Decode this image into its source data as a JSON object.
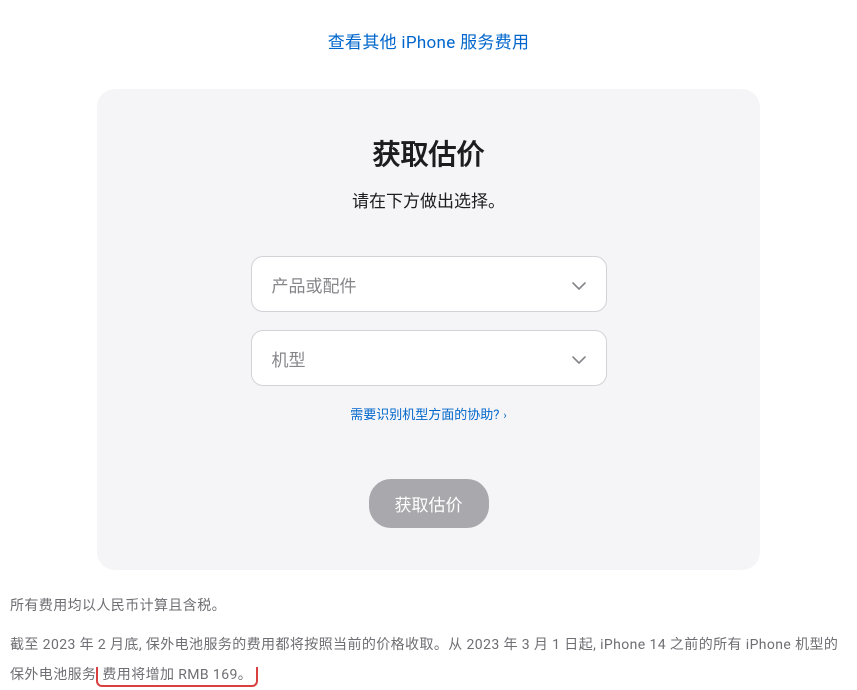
{
  "top_link": {
    "label": "查看其他 iPhone 服务费用"
  },
  "card": {
    "title": "获取估价",
    "subtitle": "请在下方做出选择。",
    "product_select": {
      "placeholder": "产品或配件"
    },
    "model_select": {
      "placeholder": "机型"
    },
    "help_link": {
      "label": "需要识别机型方面的协助?"
    },
    "estimate_button": {
      "label": "获取估价"
    }
  },
  "footer": {
    "line1": "所有费用均以人民币计算且含税。",
    "line2_part1": "截至 2023 年 2 月底, 保外电池服务的费用都将按照当前的价格收取。从 2023 年 3 月 1 日起, iPhone 14 之前的所有 iPhone 机型的保外电池服务",
    "line2_part2": "费用将增加 RMB 169。"
  }
}
